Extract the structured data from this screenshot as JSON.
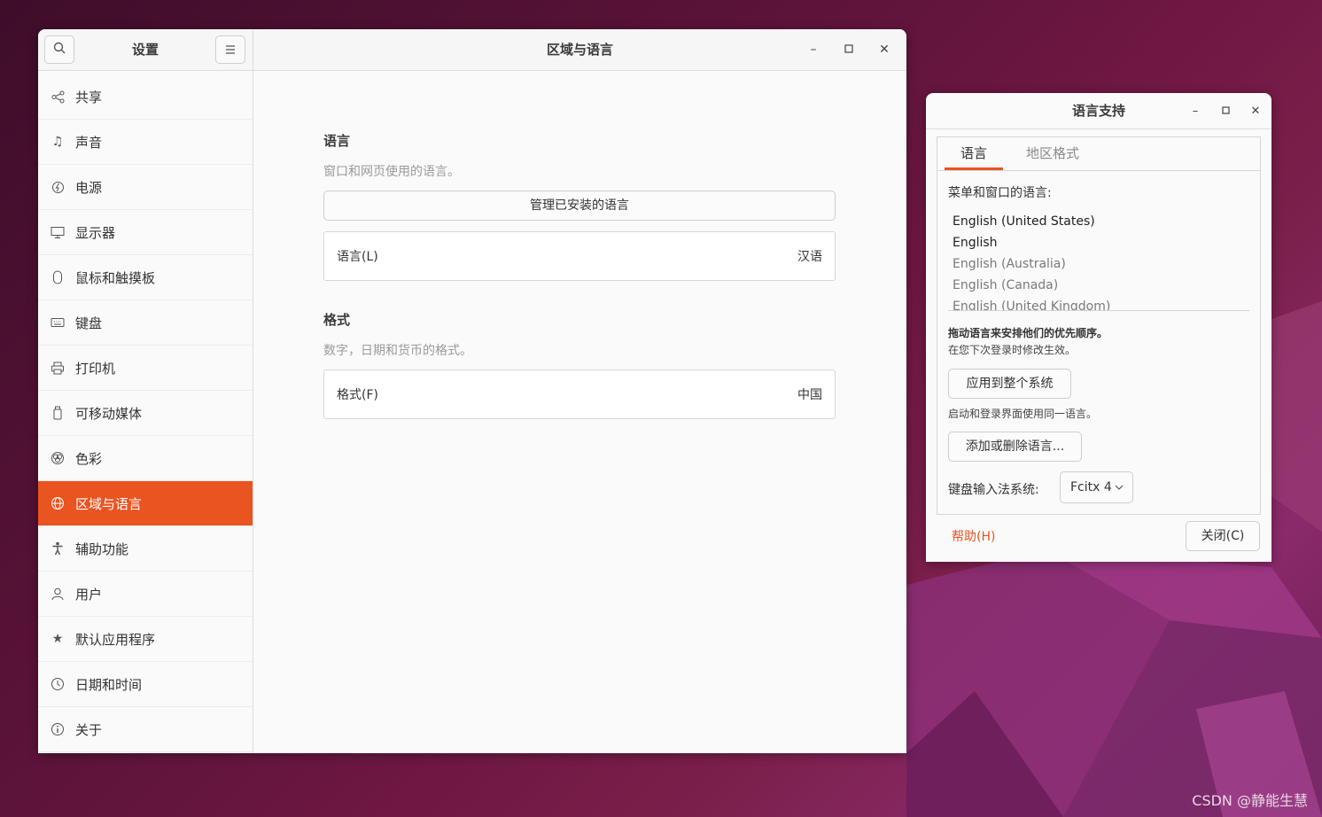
{
  "settings": {
    "title": "设置",
    "main_title": "区域与语言",
    "sidebar": {
      "items": [
        {
          "label": "共享",
          "icon": "share-icon",
          "active": false
        },
        {
          "label": "声音",
          "icon": "music-note-icon",
          "active": false
        },
        {
          "label": "电源",
          "icon": "power-icon",
          "active": false
        },
        {
          "label": "显示器",
          "icon": "display-icon",
          "active": false
        },
        {
          "label": "鼠标和触摸板",
          "icon": "mouse-icon",
          "active": false
        },
        {
          "label": "键盘",
          "icon": "keyboard-icon",
          "active": false
        },
        {
          "label": "打印机",
          "icon": "printer-icon",
          "active": false
        },
        {
          "label": "可移动媒体",
          "icon": "removable-media-icon",
          "active": false
        },
        {
          "label": "色彩",
          "icon": "color-icon",
          "active": false
        },
        {
          "label": "区域与语言",
          "icon": "globe-icon",
          "active": true
        },
        {
          "label": "辅助功能",
          "icon": "accessibility-icon",
          "active": false
        },
        {
          "label": "用户",
          "icon": "user-icon",
          "active": false
        },
        {
          "label": "默认应用程序",
          "icon": "star-icon",
          "active": false
        },
        {
          "label": "日期和时间",
          "icon": "clock-icon",
          "active": false
        },
        {
          "label": "关于",
          "icon": "info-icon",
          "active": false
        }
      ]
    },
    "language_section": {
      "title": "语言",
      "subtitle": "窗口和网页使用的语言。",
      "manage_button": "管理已安装的语言",
      "row_label": "语言(L)",
      "row_value": "汉语"
    },
    "format_section": {
      "title": "格式",
      "subtitle": "数字，日期和货币的格式。",
      "row_label": "格式(F)",
      "row_value": "中国"
    }
  },
  "language_support": {
    "title": "语言支持",
    "tabs": [
      "语言",
      "地区格式"
    ],
    "menu_label": "菜单和窗口的语言:",
    "languages": [
      {
        "name": "English (United States)",
        "style": "strong"
      },
      {
        "name": "English",
        "style": "strong"
      },
      {
        "name": "English (Australia)",
        "style": "dim"
      },
      {
        "name": "English (Canada)",
        "style": "dim"
      },
      {
        "name": "English (United Kingdom)",
        "style": "dim"
      }
    ],
    "drag_hint": "拖动语言来安排他们的优先顺序。",
    "login_hint": "在您下次登录时修改生效。",
    "apply_button": "应用到整个系统",
    "apply_hint": "启动和登录界面使用同一语言。",
    "add_remove_button": "添加或删除语言...",
    "input_method_label": "键盘输入法系统:",
    "input_method_value": "Fcitx 4",
    "help_button": "帮助(H)",
    "close_button": "关闭(C)"
  },
  "watermark": "CSDN @静能生慧",
  "colors": {
    "accent": "#e95420"
  }
}
